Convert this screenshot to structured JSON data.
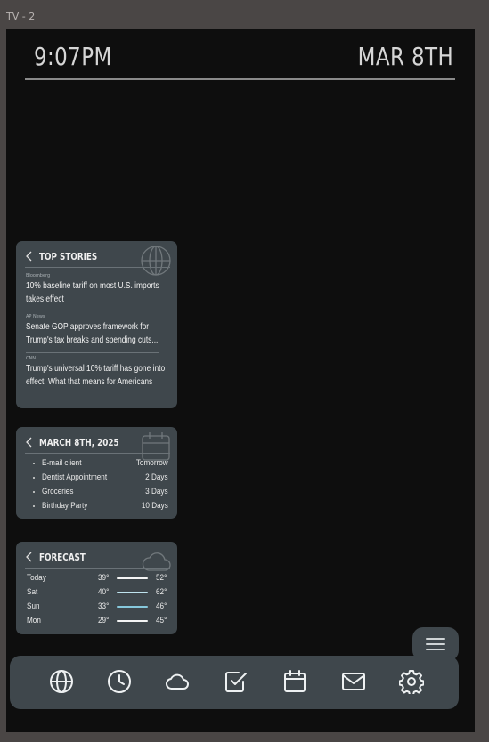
{
  "frame": {
    "label": "TV - 2"
  },
  "header": {
    "time": "9:07PM",
    "date": "MAR 8TH"
  },
  "top_stories": {
    "title": "TOP STORIES",
    "icon": "globe-icon",
    "items": [
      {
        "source": "Bloomberg",
        "headline": "10% baseline tariff on most U.S. imports takes effect"
      },
      {
        "source": "AP News",
        "headline": "Senate GOP approves framework for Trump's tax breaks and spending cuts..."
      },
      {
        "source": "CNN",
        "headline": "Trump's universal 10% tariff has gone into effect. What that means for Americans"
      }
    ]
  },
  "calendar": {
    "title": "MARCH 8TH, 2025",
    "icon": "calendar-icon",
    "events": [
      {
        "name": "E-mail client",
        "when": "Tomorrow"
      },
      {
        "name": "Dentist Appointment",
        "when": "2 Days"
      },
      {
        "name": "Groceries",
        "when": "3 Days"
      },
      {
        "name": "Birthday Party",
        "when": "10 Days"
      }
    ]
  },
  "forecast": {
    "title": "FORECAST",
    "icon": "cloud-icon",
    "days": [
      {
        "day": "Today",
        "low": "39°",
        "high": "52°",
        "bar_color": "#f4f4f4"
      },
      {
        "day": "Sat",
        "low": "40°",
        "high": "62°",
        "bar_color": "#bfe3ee"
      },
      {
        "day": "Sun",
        "low": "33°",
        "high": "46°",
        "bar_color": "#86c8dc"
      },
      {
        "day": "Mon",
        "low": "29°",
        "high": "45°",
        "bar_color": "#f4f4f4"
      }
    ]
  },
  "menu_button": {
    "icon": "hamburger-menu-icon"
  },
  "dock": {
    "items": [
      {
        "icon": "globe-icon"
      },
      {
        "icon": "clock-icon"
      },
      {
        "icon": "cloud-icon"
      },
      {
        "icon": "checkbox-icon"
      },
      {
        "icon": "calendar-icon"
      },
      {
        "icon": "mail-icon"
      },
      {
        "icon": "gear-icon"
      }
    ]
  },
  "colors": {
    "screen": "#0e0e0e",
    "widget": "#3f474c",
    "frame": "#4a4645",
    "text": "#f0f0f0"
  }
}
